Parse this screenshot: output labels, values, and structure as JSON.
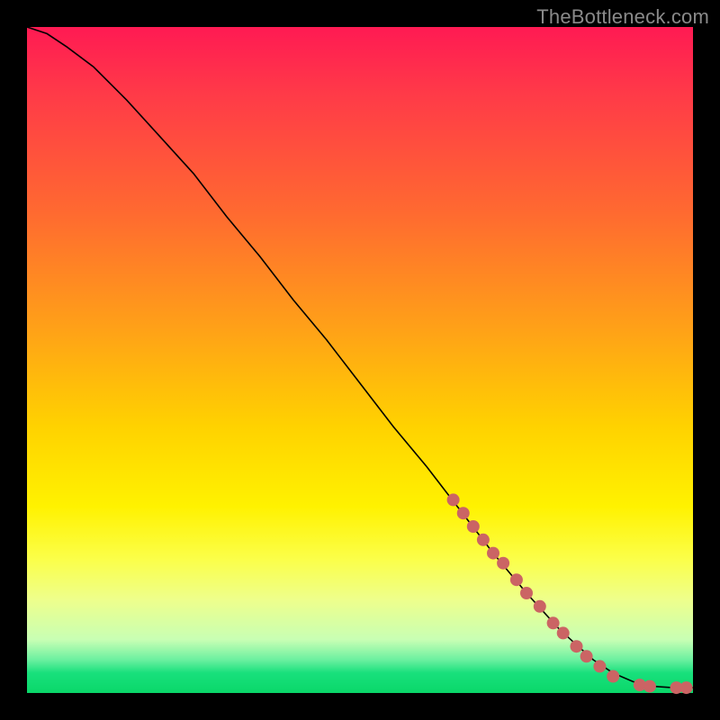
{
  "watermark": "TheBottleneck.com",
  "colors": {
    "page_bg": "#000000",
    "line": "#000000",
    "dot": "#cb6464",
    "gradient_top": "#ff1a53",
    "gradient_bottom": "#0ad769"
  },
  "chart_data": {
    "type": "line",
    "title": "",
    "xlabel": "",
    "ylabel": "",
    "xlim": [
      0,
      100
    ],
    "ylim": [
      0,
      100
    ],
    "series": [
      {
        "name": "bottleneck-curve",
        "x": [
          0,
          3,
          6,
          10,
          15,
          20,
          25,
          30,
          35,
          40,
          45,
          50,
          55,
          60,
          65,
          70,
          75,
          80,
          85,
          88,
          91,
          94,
          97,
          100
        ],
        "y": [
          100,
          99,
          97,
          94,
          89,
          83.5,
          78,
          71.5,
          65.5,
          59,
          53,
          46.5,
          40,
          34,
          27.5,
          21,
          15,
          9.5,
          5,
          3,
          1.7,
          1,
          0.8,
          0.8
        ]
      }
    ],
    "markers": [
      {
        "x": 64,
        "y": 29
      },
      {
        "x": 65.5,
        "y": 27
      },
      {
        "x": 67,
        "y": 25
      },
      {
        "x": 68.5,
        "y": 23
      },
      {
        "x": 70,
        "y": 21
      },
      {
        "x": 71.5,
        "y": 19.5
      },
      {
        "x": 73.5,
        "y": 17
      },
      {
        "x": 75,
        "y": 15
      },
      {
        "x": 77,
        "y": 13
      },
      {
        "x": 79,
        "y": 10.5
      },
      {
        "x": 80.5,
        "y": 9
      },
      {
        "x": 82.5,
        "y": 7
      },
      {
        "x": 84,
        "y": 5.5
      },
      {
        "x": 86,
        "y": 4
      },
      {
        "x": 88,
        "y": 2.5
      },
      {
        "x": 92,
        "y": 1.2
      },
      {
        "x": 93.5,
        "y": 1
      },
      {
        "x": 97.5,
        "y": 0.8
      },
      {
        "x": 99,
        "y": 0.8
      }
    ],
    "marker_radius_px": 7
  }
}
